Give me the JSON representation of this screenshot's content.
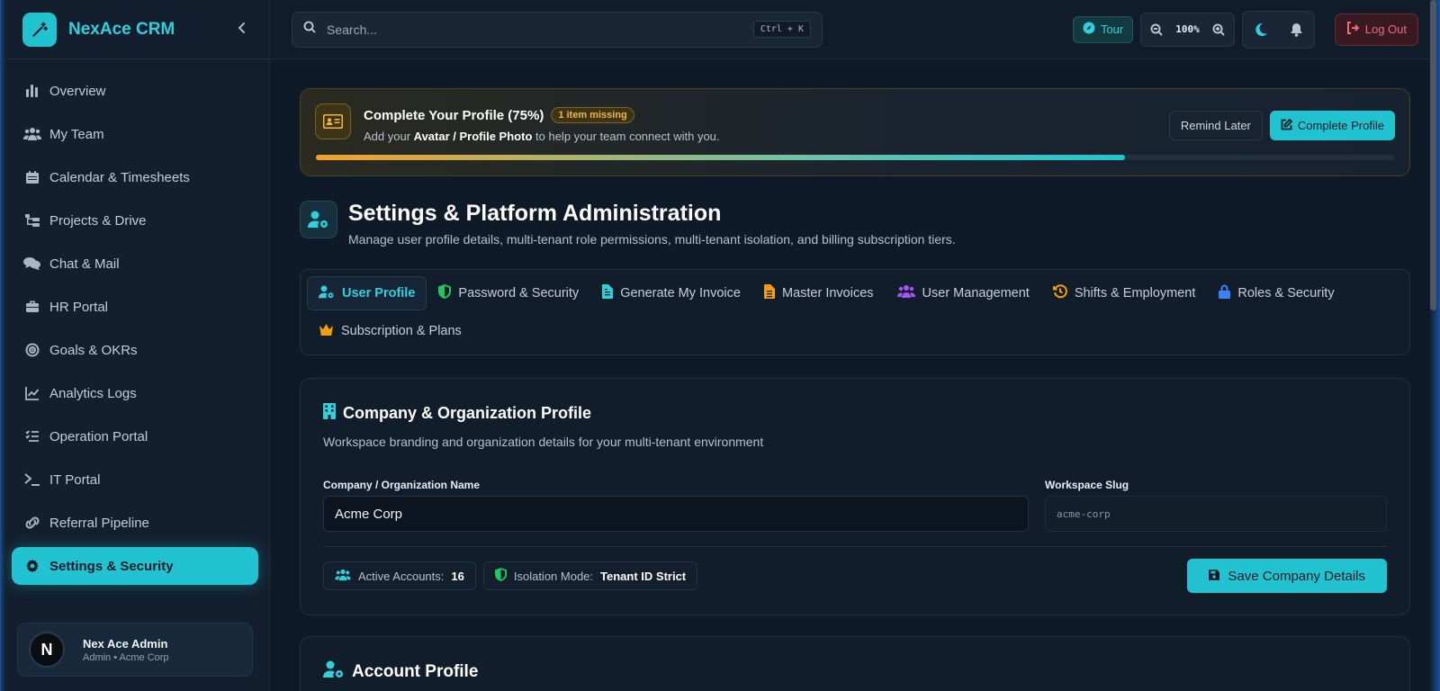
{
  "brand": {
    "name": "NexAce CRM"
  },
  "sidebar": {
    "items": [
      {
        "label": "Overview",
        "icon": "bar-chart-icon"
      },
      {
        "label": "My Team",
        "icon": "users-icon"
      },
      {
        "label": "Calendar & Timesheets",
        "icon": "calendar-icon"
      },
      {
        "label": "Projects & Drive",
        "icon": "folder-tree-icon"
      },
      {
        "label": "Chat & Mail",
        "icon": "comments-icon"
      },
      {
        "label": "HR Portal",
        "icon": "briefcase-icon"
      },
      {
        "label": "Goals & OKRs",
        "icon": "target-icon"
      },
      {
        "label": "Analytics Logs",
        "icon": "line-chart-icon"
      },
      {
        "label": "Operation Portal",
        "icon": "list-check-icon"
      },
      {
        "label": "IT Portal",
        "icon": "terminal-icon"
      },
      {
        "label": "Referral Pipeline",
        "icon": "link-icon"
      },
      {
        "label": "Settings & Security",
        "icon": "gear-icon",
        "active": true
      }
    ],
    "user": {
      "initial": "N",
      "name": "Nex Ace Admin",
      "role": "Admin • Acme Corp"
    }
  },
  "topbar": {
    "search_placeholder": "Search...",
    "shortcut": "Ctrl + K",
    "tour_label": "Tour",
    "zoom": "100%",
    "logout_label": "Log Out"
  },
  "banner": {
    "title": "Complete Your Profile (75%)",
    "badge": "1 item missing",
    "sub_prefix": "Add your",
    "sub_highlight": "Avatar / Profile Photo",
    "sub_suffix": "to help your team connect with you.",
    "remind_label": "Remind Later",
    "complete_label": "Complete Profile",
    "progress": 0.75
  },
  "page": {
    "title": "Settings & Platform Administration",
    "subtitle": "Manage user profile details, multi-tenant role permissions, multi-tenant isolation, and billing subscription tiers."
  },
  "tabs": [
    {
      "label": "User Profile",
      "icon": "user-gear-icon",
      "color": "#2fd0dc",
      "active": true
    },
    {
      "label": "Password & Security",
      "icon": "shield-icon",
      "color": "#22c55e"
    },
    {
      "label": "Generate My Invoice",
      "icon": "file-invoice-icon",
      "color": "#2fd0dc"
    },
    {
      "label": "Master Invoices",
      "icon": "file-icon",
      "color": "#f59e0b"
    },
    {
      "label": "User Management",
      "icon": "users-icon",
      "color": "#a855f7"
    },
    {
      "label": "Shifts & Employment",
      "icon": "history-icon",
      "color": "#f59e0b"
    },
    {
      "label": "Roles & Security",
      "icon": "lock-icon",
      "color": "#3b82f6"
    },
    {
      "label": "Subscription & Plans",
      "icon": "crown-icon",
      "color": "#f59e0b"
    }
  ],
  "company": {
    "title": "Company & Organization Profile",
    "subtitle": "Workspace branding and organization details for your multi-tenant environment",
    "name_label": "Company / Organization Name",
    "name_value": "Acme Corp",
    "slug_label": "Workspace Slug",
    "slug_value": "acme-corp",
    "accounts_label": "Active Accounts:",
    "accounts_value": "16",
    "isolation_label": "Isolation Mode:",
    "isolation_value": "Tenant ID Strict",
    "save_label": "Save Company Details"
  },
  "account": {
    "title": "Account Profile"
  },
  "colors": {
    "accent": "#22c3d1",
    "warning": "#f4b53a",
    "danger": "#ef6b78"
  }
}
